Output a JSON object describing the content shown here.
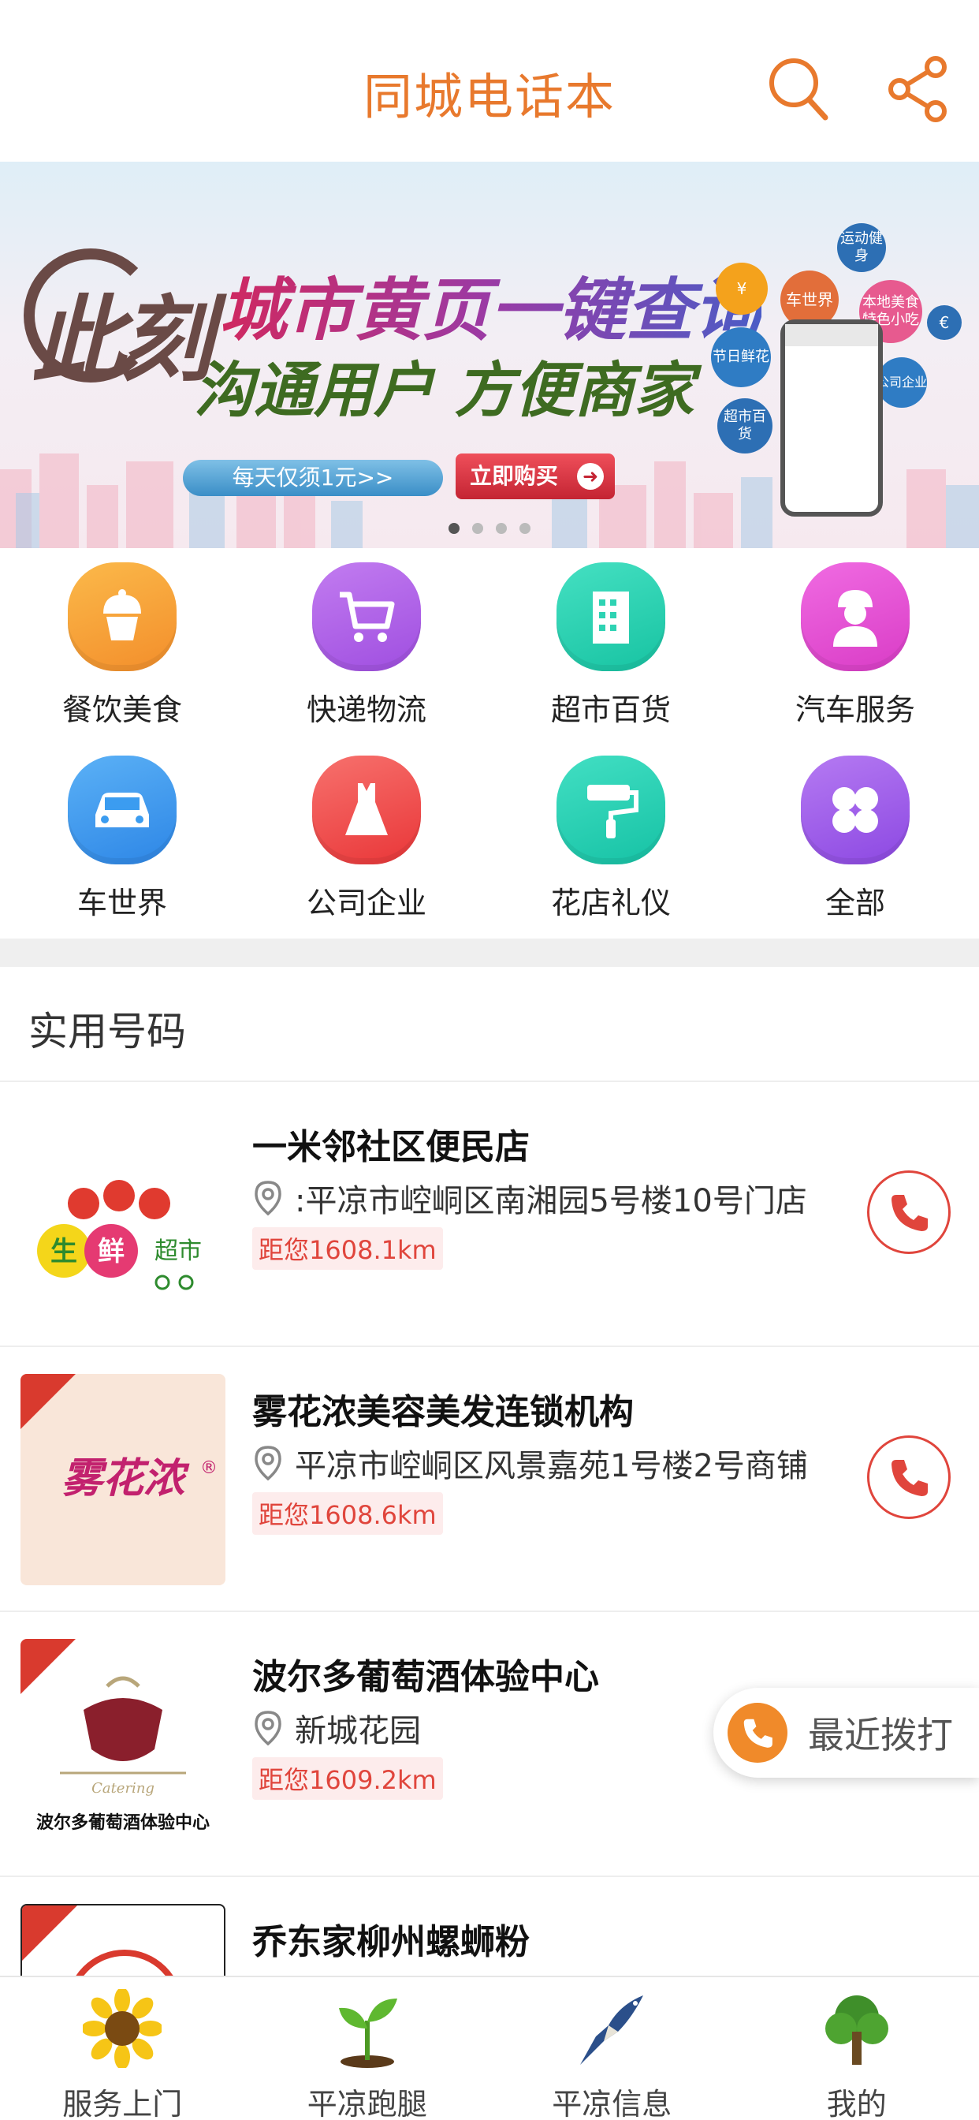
{
  "header": {
    "title": "同城电话本"
  },
  "banner": {
    "brand": "此刻",
    "headline": "城市黄页一键查询",
    "subline": "沟通用户 方便商家",
    "price_pill": "每天仅须1元>>",
    "buy_button": "立即购买",
    "bubbles": [
      "节日鲜花",
      "车世界",
      "本地美食特色小吃",
      "超市百货",
      "公司企业",
      "运动健身"
    ],
    "slide_count": 4,
    "active_slide": 1
  },
  "categories": [
    {
      "label": "餐饮美食",
      "icon": "cupcake-icon",
      "color": "#F7A23A"
    },
    {
      "label": "快递物流",
      "icon": "cart-icon",
      "color": "#B162E6"
    },
    {
      "label": "超市百货",
      "icon": "building-icon",
      "color": "#2ED3B3"
    },
    {
      "label": "汽车服务",
      "icon": "mechanic-icon",
      "color": "#E24FD2"
    },
    {
      "label": "车世界",
      "icon": "car-icon",
      "color": "#3B9CF0"
    },
    {
      "label": "公司企业",
      "icon": "dress-icon",
      "color": "#F2504F"
    },
    {
      "label": "花店礼仪",
      "icon": "paint-roller-icon",
      "color": "#29CDB0"
    },
    {
      "label": "全部",
      "icon": "clover-icon",
      "color": "#9E5BE8"
    }
  ],
  "section": {
    "title": "实用号码"
  },
  "listings": [
    {
      "name": "一米邻社区便民店",
      "address": ":平凉市崆峒区南湘园5号楼10号门店",
      "distance": "距您1608.1km",
      "logo_text": "生鲜超市"
    },
    {
      "name": "雾花浓美容美发连锁机构",
      "address": "平凉市崆峒区风景嘉苑1号楼2号商铺",
      "distance": "距您1608.6km",
      "logo_text": "雾花浓®"
    },
    {
      "name": "波尔多葡萄酒体验中心",
      "address": "新城花园",
      "distance": "距您1609.2km",
      "logo_text": "波尔多葡萄酒体验中心"
    },
    {
      "name": "乔东家柳州螺蛳粉",
      "address": "",
      "distance": "",
      "logo_text": ""
    }
  ],
  "recent_calls": {
    "label": "最近拨打"
  },
  "bottom_nav": [
    {
      "label": "服务上门",
      "icon": "sunflower-icon"
    },
    {
      "label": "平凉跑腿",
      "icon": "sprout-icon"
    },
    {
      "label": "平凉信息",
      "icon": "swallow-icon"
    },
    {
      "label": "我的",
      "icon": "tree-icon"
    }
  ],
  "colors": {
    "accent": "#E8792D",
    "call_red": "#E0453C",
    "distance_bg": "#FDECEC"
  }
}
